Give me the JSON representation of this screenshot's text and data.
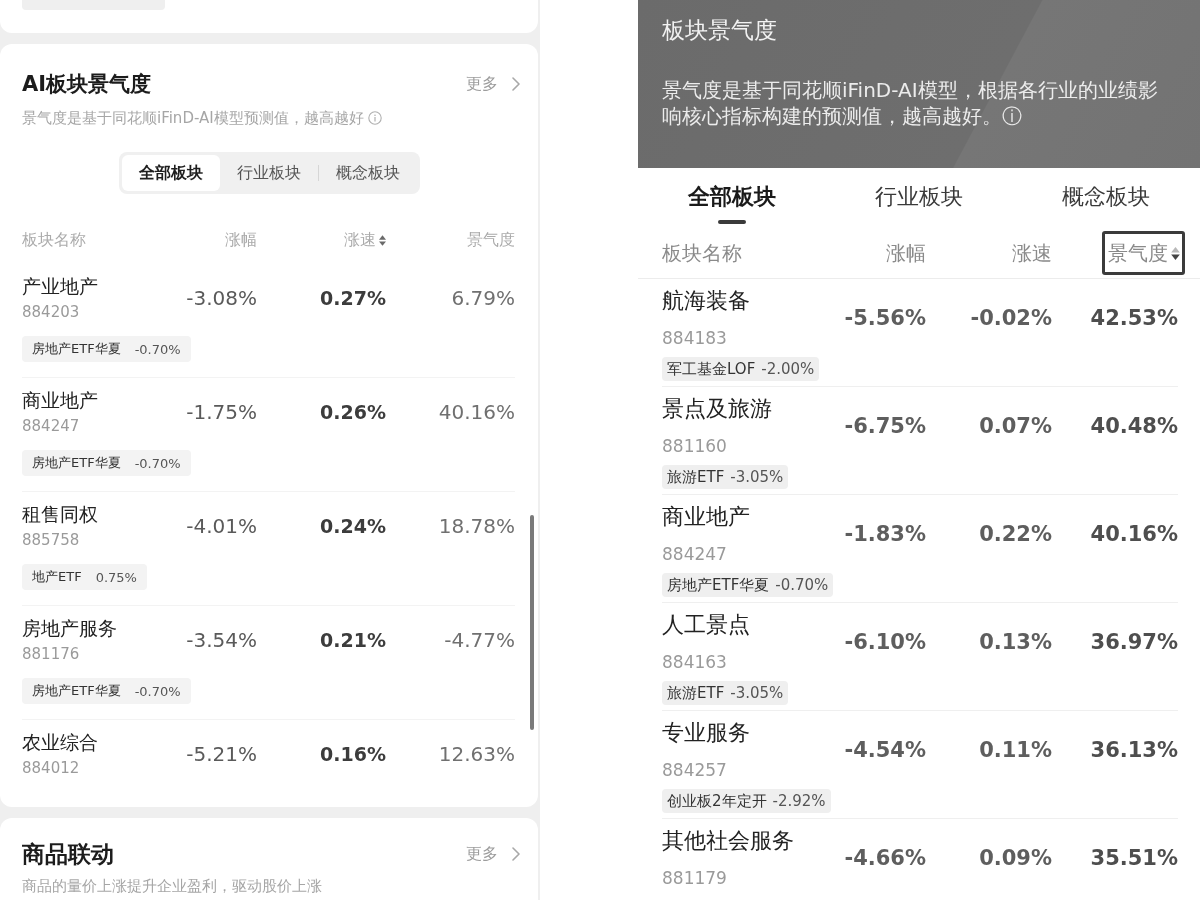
{
  "left_screen": {
    "sector_card": {
      "title": "AI板块景气度",
      "more_link": "更多",
      "subtitle": "景气度是基于同花顺iFinD-AI模型预测值，越高越好",
      "segments": [
        {
          "label": "全部板块",
          "selected": true
        },
        {
          "label": "行业板块",
          "selected": false
        },
        {
          "label": "概念板块",
          "selected": false
        }
      ],
      "columns": [
        {
          "label": "板块名称",
          "sortable": false
        },
        {
          "label": "涨幅",
          "sortable": false
        },
        {
          "label": "涨速",
          "sortable": true
        },
        {
          "label": "景气度",
          "sortable": false
        }
      ],
      "rows": [
        {
          "name": "产业地产",
          "code": "884203",
          "change": "-3.08%",
          "speed": "0.27%",
          "prosperity": "6.79%",
          "fund": {
            "name": "房地产ETF华夏",
            "change": "-0.70%"
          }
        },
        {
          "name": "商业地产",
          "code": "884247",
          "change": "-1.75%",
          "speed": "0.26%",
          "prosperity": "40.16%",
          "fund": {
            "name": "房地产ETF华夏",
            "change": "-0.70%"
          }
        },
        {
          "name": "租售同权",
          "code": "885758",
          "change": "-4.01%",
          "speed": "0.24%",
          "prosperity": "18.78%",
          "fund": {
            "name": "地产ETF",
            "change": "0.75%"
          }
        },
        {
          "name": "房地产服务",
          "code": "881176",
          "change": "-3.54%",
          "speed": "0.21%",
          "prosperity": "-4.77%",
          "fund": {
            "name": "房地产ETF华夏",
            "change": "-0.70%"
          }
        },
        {
          "name": "农业综合",
          "code": "884012",
          "change": "-5.21%",
          "speed": "0.16%",
          "prosperity": "12.63%"
        }
      ]
    },
    "commodity_card": {
      "title": "商品联动",
      "more_link": "更多",
      "subtitle": "商品的量价上涨提升企业盈利，驱动股价上涨"
    }
  },
  "right_screen": {
    "banner": {
      "title": "板块景气度",
      "description": "景气度是基于同花顺iFinD-AI模型，根据各行业的业绩影响核心指标构建的预测值，越高越好。ⓘ"
    },
    "tabs": [
      {
        "label": "全部板块",
        "selected": true
      },
      {
        "label": "行业板块",
        "selected": false
      },
      {
        "label": "概念板块",
        "selected": false
      }
    ],
    "columns": [
      {
        "label": "板块名称",
        "sortable": false,
        "sorted": false,
        "outlined": false
      },
      {
        "label": "涨幅",
        "sortable": false,
        "sorted": false,
        "outlined": false
      },
      {
        "label": "涨速",
        "sortable": false,
        "sorted": false,
        "outlined": false
      },
      {
        "label": "景气度",
        "sortable": true,
        "sorted": true,
        "outlined": true
      }
    ],
    "rows": [
      {
        "name": "航海装备",
        "code": "884183",
        "change": "-5.56%",
        "speed": "-0.02%",
        "prosperity": "42.53%",
        "fund": {
          "name": "军工基金LOF",
          "change": "-2.00%"
        }
      },
      {
        "name": "景点及旅游",
        "code": "881160",
        "change": "-6.75%",
        "speed": "0.07%",
        "prosperity": "40.48%",
        "fund": {
          "name": "旅游ETF",
          "change": "-3.05%"
        }
      },
      {
        "name": "商业地产",
        "code": "884247",
        "change": "-1.83%",
        "speed": "0.22%",
        "prosperity": "40.16%",
        "fund": {
          "name": "房地产ETF华夏",
          "change": "-0.70%"
        }
      },
      {
        "name": "人工景点",
        "code": "884163",
        "change": "-6.10%",
        "speed": "0.13%",
        "prosperity": "36.97%",
        "fund": {
          "name": "旅游ETF",
          "change": "-3.05%"
        }
      },
      {
        "name": "专业服务",
        "code": "884257",
        "change": "-4.54%",
        "speed": "0.11%",
        "prosperity": "36.13%",
        "fund": {
          "name": "创业板2年定开",
          "change": "-2.92%"
        }
      },
      {
        "name": "其他社会服务",
        "code": "881179",
        "change": "-4.66%",
        "speed": "0.09%",
        "prosperity": "35.51%"
      }
    ]
  }
}
